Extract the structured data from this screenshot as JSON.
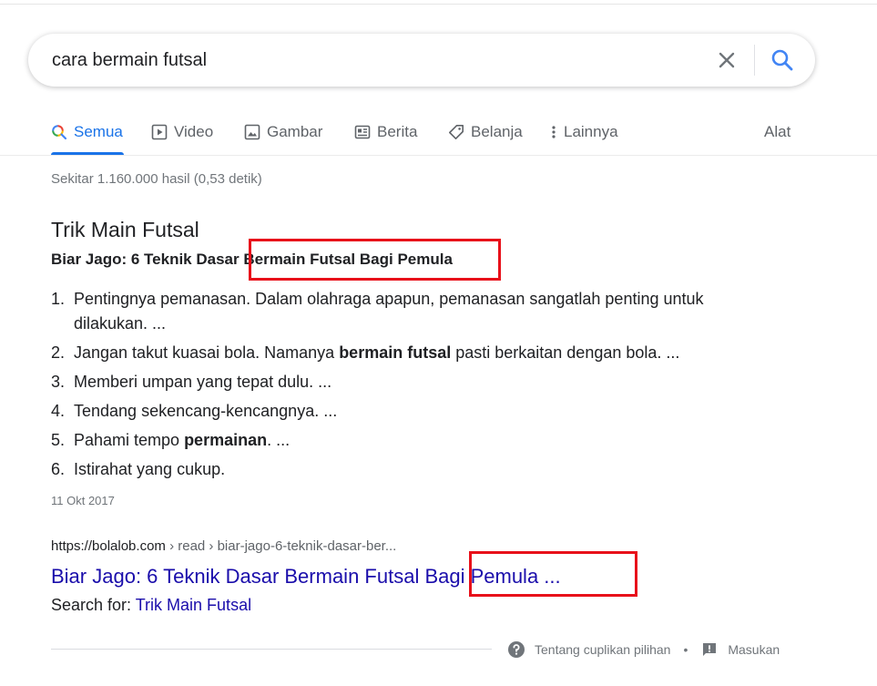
{
  "search": {
    "query": "cara bermain futsal"
  },
  "tabs": [
    {
      "label": "Semua",
      "icon": "search-icon"
    },
    {
      "label": "Video",
      "icon": "video-icon"
    },
    {
      "label": "Gambar",
      "icon": "image-icon"
    },
    {
      "label": "Berita",
      "icon": "news-icon"
    },
    {
      "label": "Belanja",
      "icon": "tag-icon"
    },
    {
      "label": "Lainnya",
      "icon": "more-vertical-icon"
    }
  ],
  "tools_label": "Alat",
  "stats": "Sekitar 1.160.000 hasil (0,53 detik)",
  "snippet": {
    "title": "Trik Main Futsal",
    "subtitle_plain": "Biar Jago: 6 Teknik Dasar ",
    "subtitle_highlight": "Bermain Futsal Bagi Pemula",
    "items": [
      {
        "num": "1.",
        "pre": "Pentingnya pemanasan. Dalam olahraga apapun, pemanasan sangatlah penting untuk dilakukan. ...",
        "bold": "",
        "post": ""
      },
      {
        "num": "2.",
        "pre": "Jangan takut kuasai bola. Namanya ",
        "bold": "bermain futsal",
        "post": " pasti berkaitan dengan bola. ..."
      },
      {
        "num": "3.",
        "pre": "Memberi umpan yang tepat dulu. ...",
        "bold": "",
        "post": ""
      },
      {
        "num": "4.",
        "pre": "Tendang sekencang-kencangnya. ...",
        "bold": "",
        "post": ""
      },
      {
        "num": "5.",
        "pre": "Pahami tempo ",
        "bold": "permainan",
        "post": ". ..."
      },
      {
        "num": "6.",
        "pre": "Istirahat yang cukup.",
        "bold": "",
        "post": ""
      }
    ],
    "date": "11 Okt 2017"
  },
  "result": {
    "url_domain": "https://bolalob.com",
    "url_path": " › read › biar-jago-6-teknik-dasar-ber...",
    "title": "Biar Jago: 6 Teknik Dasar Bermain Futsal Bagi Pemula ...",
    "search_for_label": "Search for: ",
    "search_for_link": "Trik Main Futsal"
  },
  "footer": {
    "about_label": "Tentang cuplikan pilihan",
    "separator": "•",
    "feedback_label": "Masukan"
  },
  "colors": {
    "accent": "#1a73e8",
    "link": "#1a0dab",
    "highlight_box": "#e8101a"
  }
}
